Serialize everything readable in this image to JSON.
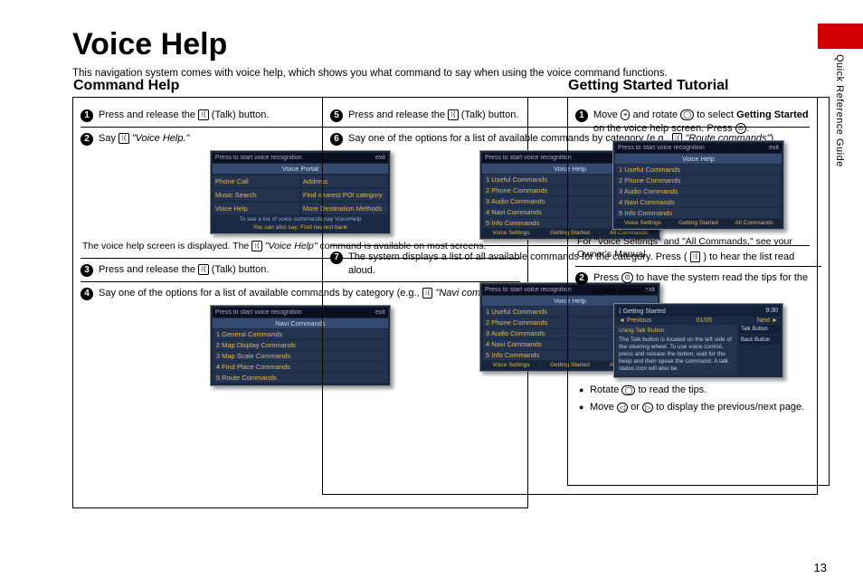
{
  "page": {
    "title": "Voice Help",
    "intro": "This navigation system comes with voice help, which shows you what command to say when using the voice command functions.",
    "side_label": "Quick Reference Guide",
    "page_number": "13"
  },
  "command_help": {
    "heading": "Command Help",
    "steps": {
      "s1": "Press and release the ",
      "s1b": " (Talk) button.",
      "s2a": "Say ",
      "s2b": "\"Voice Help.\"",
      "caption1a": "The voice help screen is displayed. The ",
      "caption1b": "\"Voice Help\"",
      "caption1c": " command is available on most screens.",
      "s3": "Press and release the ",
      "s3b": " (Talk) button.",
      "s4a": "Say one of the options for a list of available commands by category (e.g., ",
      "s4b": "\"Navi commands\"",
      "s4c": ").",
      "s5": "Press and release the ",
      "s5b": " (Talk) button.",
      "s6a": "Say one of the options for a list of available commands by category (e.g., ",
      "s6b": "\"Route commands\"",
      "s6c": ").",
      "s7": "The system displays a list of all available commands for the category. Press ( ",
      "s7b": " ) to hear the list read aloud."
    },
    "shot1": {
      "bar_left": "Press  to start voice recognition",
      "bar_right": "exit",
      "title": "Voice Portal",
      "cells": [
        "Phone Call",
        "Address",
        "Music Search",
        "Find nearest POI category",
        "Voice Help",
        "More Destination Methods"
      ],
      "footer1": "To see a list of voice commands,say VoiceHelp",
      "footer2": "You can also say: Find nearest bank"
    },
    "shot_navi": {
      "title": "Navi Commands",
      "items": [
        "1  General Commands",
        "2  Map Display Commands",
        "3  Map Scale Commands",
        "4  Find Place Commands",
        "5  Route Commands"
      ]
    },
    "shot_help": {
      "title": "Voice Help",
      "items": [
        "1  Useful Commands",
        "2  Phone Commands",
        "3  Audio Commands",
        "4  Navi Commands",
        "5  Info Commands"
      ],
      "tabs": [
        "Voice Settings",
        "Getting Started",
        "All Commands"
      ]
    }
  },
  "tutorial": {
    "heading": "Getting Started Tutorial",
    "s1a": "Move ",
    "s1b": " and rotate ",
    "s1c": " to select ",
    "s1d": "Getting Started",
    "s1e": " on the voice help screen. Press ",
    "s1f": ".",
    "caption": "For \"Voice Settings\" and \"All Commands,\" see your Owner's Manual.",
    "s2a": "Press ",
    "s2b": " to have the system read the tips for the voice control.",
    "shot2": {
      "top_left": "Getting Started",
      "top_right": "9:30",
      "prev": "Previous",
      "page": "01/05",
      "next": "Next",
      "panel_title": "Using Talk Button",
      "panel_body": "The Talk button is located on the left side of the steering wheel. To use voice control, press and release the button, wait for the beep and then speak the command. A talk status icon will also be",
      "side_btns": [
        "Talk Button",
        "Back Button"
      ]
    },
    "bullets": {
      "b1a": "Rotate ",
      "b1b": " to read the tips.",
      "b2a": "Move ",
      "b2b": " or ",
      "b2c": " to display the previous/next page."
    }
  }
}
